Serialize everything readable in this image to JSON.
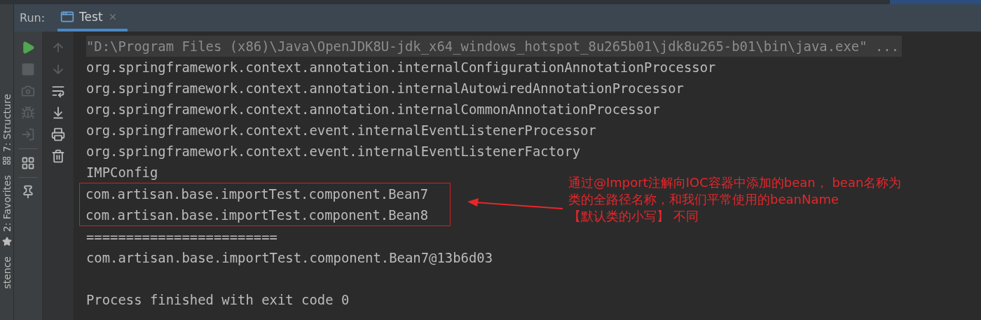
{
  "tool_window_bar": {
    "items": [
      {
        "label": "7: Structure",
        "kind": "structure"
      },
      {
        "label": "2: Favorites",
        "kind": "favorites"
      },
      {
        "label": "stence",
        "kind": "plain"
      }
    ]
  },
  "run_panel": {
    "title": "Run:",
    "tabs": [
      {
        "label": "Test",
        "selected": true
      }
    ]
  },
  "toolbar_left": [
    {
      "kind": "run",
      "disabled": false
    },
    {
      "kind": "stop",
      "disabled": true
    },
    {
      "kind": "camera",
      "disabled": true
    },
    {
      "kind": "bug",
      "disabled": true
    },
    {
      "kind": "exit",
      "disabled": true
    },
    {
      "kind": "separator"
    },
    {
      "kind": "layout",
      "disabled": false
    },
    {
      "kind": "separator"
    },
    {
      "kind": "pin",
      "disabled": false
    }
  ],
  "toolbar_right": [
    {
      "kind": "up",
      "disabled": true
    },
    {
      "kind": "down",
      "disabled": true
    },
    {
      "kind": "wrap",
      "disabled": false
    },
    {
      "kind": "scroll-end",
      "disabled": false
    },
    {
      "kind": "print",
      "disabled": false
    },
    {
      "kind": "trash",
      "disabled": false
    }
  ],
  "console": {
    "lines": [
      {
        "text": "\"D:\\Program Files (x86)\\Java\\OpenJDK8U-jdk_x64_windows_hotspot_8u265b01\\jdk8u265-b01\\bin\\java.exe\" ...",
        "kind": "command",
        "boxed": false
      },
      {
        "text": "org.springframework.context.annotation.internalConfigurationAnnotationProcessor",
        "kind": "output",
        "boxed": false
      },
      {
        "text": "org.springframework.context.annotation.internalAutowiredAnnotationProcessor",
        "kind": "output",
        "boxed": false
      },
      {
        "text": "org.springframework.context.annotation.internalCommonAnnotationProcessor",
        "kind": "output",
        "boxed": false
      },
      {
        "text": "org.springframework.context.event.internalEventListenerProcessor",
        "kind": "output",
        "boxed": false
      },
      {
        "text": "org.springframework.context.event.internalEventListenerFactory",
        "kind": "output",
        "boxed": false
      },
      {
        "text": "IMPConfig",
        "kind": "output",
        "boxed": false
      },
      {
        "text": "com.artisan.base.importTest.component.Bean7",
        "kind": "output",
        "boxed": true
      },
      {
        "text": "com.artisan.base.importTest.component.Bean8",
        "kind": "output",
        "boxed": true
      },
      {
        "text": "========================",
        "kind": "output",
        "boxed": false
      },
      {
        "text": "com.artisan.base.importTest.component.Bean7@13b6d03",
        "kind": "output",
        "boxed": false
      },
      {
        "kind": "blank",
        "boxed": false
      },
      {
        "text": "Process finished with exit code 0",
        "kind": "output",
        "boxed": false
      }
    ]
  },
  "annotation": {
    "lines": [
      "通过@Import注解向IOC容器中添加的bean， bean名称为",
      "类的全路径名称，和我们平常使用的beanName",
      "【默认类的小写】 不同"
    ]
  }
}
